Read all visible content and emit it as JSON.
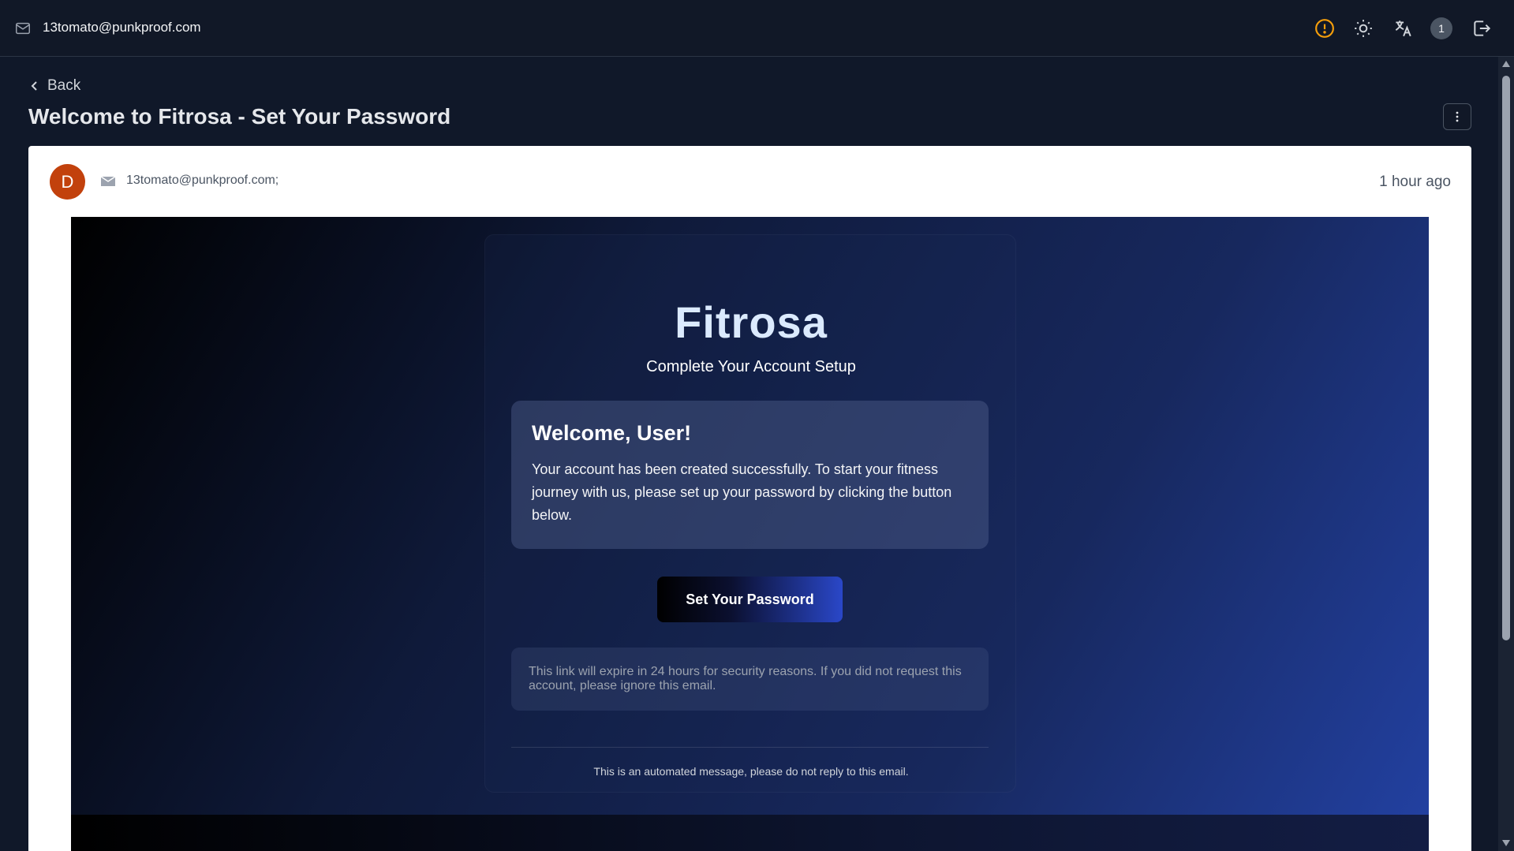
{
  "topbar": {
    "account_email": "13tomato@punkproof.com",
    "notification_count": "1",
    "icons": [
      "mail-icon",
      "alert-icon",
      "sun-icon",
      "translate-icon",
      "logout-icon"
    ],
    "alert_color": "#f59e0b"
  },
  "header": {
    "back_label": "Back",
    "title": "Welcome to Fitrosa - Set Your Password"
  },
  "message": {
    "sender_initial": "D",
    "avatar_color": "#c2410c",
    "recipients": "13tomato@punkproof.com;",
    "time_ago": "1 hour ago"
  },
  "email": {
    "brand": "Fitrosa",
    "subtitle": "Complete Your Account Setup",
    "welcome_title": "Welcome, User!",
    "welcome_text": "Your account has been created successfully. To start your fitness journey with us, please set up your password by clicking the button below.",
    "cta_label": "Set Your Password",
    "notice": "This link will expire in 24 hours for security reasons. If you did not request this account, please ignore this email.",
    "automated_note": "This is an automated message, please do not reply to this email."
  }
}
